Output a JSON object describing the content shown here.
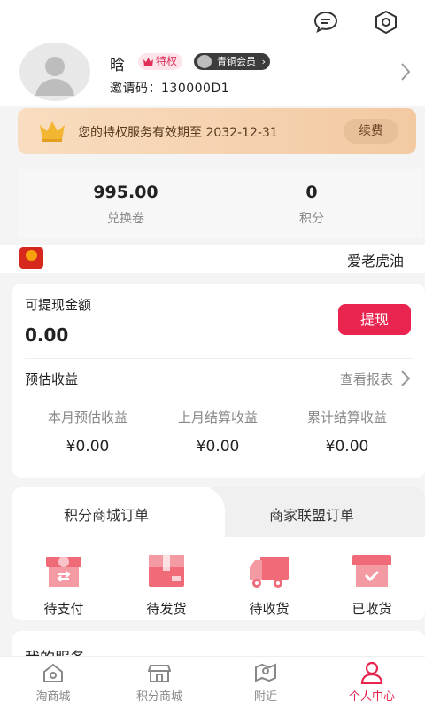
{
  "header": {
    "message_icon": "chat-bubble-icon",
    "settings_icon": "hexagon-settings-icon"
  },
  "profile": {
    "username": "晗",
    "privilege_badge": "特权",
    "level_badge": "青铜会员",
    "invite_code": "邀请码：130000D1"
  },
  "vip_banner": {
    "text": "您的特权服务有效期至 2032-12-31",
    "renew_label": "续费"
  },
  "stats": [
    {
      "value": "995.00",
      "label": "兑换卷"
    },
    {
      "value": "0",
      "label": "积分"
    }
  ],
  "ticker": {
    "text": "爱老虎油"
  },
  "earnings": {
    "title": "可提现金额",
    "amount": "0.00",
    "withdraw_label": "提现",
    "estimate_title": "预估收益",
    "report_link": "查看报表",
    "columns": [
      {
        "label": "本月预估收益",
        "value": "¥0.00"
      },
      {
        "label": "上月结算收益",
        "value": "¥0.00"
      },
      {
        "label": "累计结算收益",
        "value": "¥0.00"
      }
    ]
  },
  "orders": {
    "tabs": [
      "积分商城订单",
      "商家联盟订单"
    ],
    "items": [
      {
        "label": "待支付",
        "icon": "gift-box-icon"
      },
      {
        "label": "待发货",
        "icon": "package-icon"
      },
      {
        "label": "待收货",
        "icon": "truck-icon"
      },
      {
        "label": "已收货",
        "icon": "received-box-icon"
      }
    ]
  },
  "services": {
    "title": "我的服务"
  },
  "bottom_nav": [
    {
      "label": "淘商城",
      "icon": "home-icon"
    },
    {
      "label": "积分商城",
      "icon": "store-icon"
    },
    {
      "label": "附近",
      "icon": "map-icon"
    },
    {
      "label": "个人中心",
      "icon": "user-icon",
      "active": true
    }
  ],
  "colors": {
    "accent": "#e8244f",
    "vip_gold": "#f3c9a2"
  }
}
